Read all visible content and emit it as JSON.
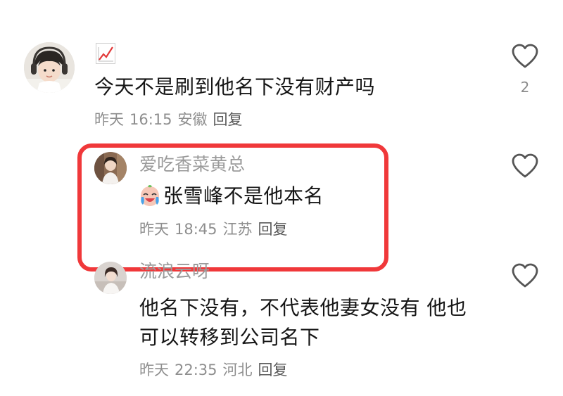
{
  "comments": [
    {
      "username": "",
      "text": "今天不是刷到他名下没有财产吗",
      "date": "昨天",
      "time": "16:15",
      "location": "安徽",
      "reply_label": "回复",
      "like_count": "2"
    },
    {
      "username": "爱吃香菜黄总",
      "text": "张雪峰不是他本名",
      "date": "昨天",
      "time": "18:45",
      "location": "江苏",
      "reply_label": "回复",
      "like_count": ""
    },
    {
      "username": "流浪云呀",
      "text_line1": "他名下没有，不代表他妻女没有 他也",
      "text_line2": "可以转移到公司名下",
      "date": "昨天",
      "time": "22:35",
      "location": "河北",
      "reply_label": "回复",
      "like_count": ""
    }
  ],
  "colors": {
    "highlight_border": "#f0383a",
    "text": "#161616",
    "meta": "#8e8e8e"
  },
  "icons": {
    "heart": "heart-outline-icon",
    "trend": "trend-chart-icon",
    "emoji": "crying-laugh-emoji-icon"
  }
}
